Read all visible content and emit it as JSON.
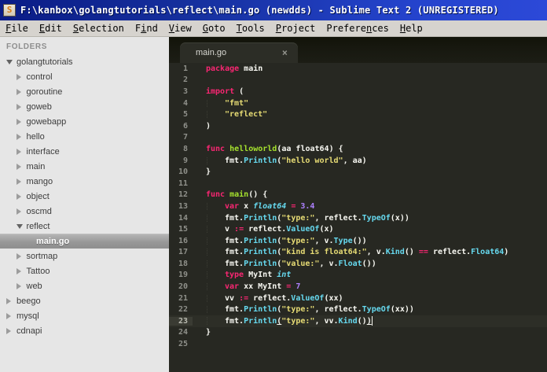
{
  "window": {
    "title": "F:\\kanbox\\golangtutorials\\reflect\\main.go (newdds) - Sublime Text 2 (UNREGISTERED)",
    "icon_letter": "S"
  },
  "menu": {
    "items": [
      {
        "label": "File",
        "underline_index": 0
      },
      {
        "label": "Edit",
        "underline_index": 0
      },
      {
        "label": "Selection",
        "underline_index": 0
      },
      {
        "label": "Find",
        "underline_index": 1
      },
      {
        "label": "View",
        "underline_index": 0
      },
      {
        "label": "Goto",
        "underline_index": 0
      },
      {
        "label": "Tools",
        "underline_index": 0
      },
      {
        "label": "Project",
        "underline_index": 0
      },
      {
        "label": "Preferences",
        "underline_index": 7
      },
      {
        "label": "Help",
        "underline_index": 0
      }
    ]
  },
  "sidebar": {
    "header": "FOLDERS",
    "items": [
      {
        "label": "golangtutorials",
        "level": 0,
        "state": "expanded",
        "selected": false
      },
      {
        "label": "control",
        "level": 1,
        "state": "collapsed",
        "selected": false
      },
      {
        "label": "goroutine",
        "level": 1,
        "state": "collapsed",
        "selected": false
      },
      {
        "label": "goweb",
        "level": 1,
        "state": "collapsed",
        "selected": false
      },
      {
        "label": "gowebapp",
        "level": 1,
        "state": "collapsed",
        "selected": false
      },
      {
        "label": "hello",
        "level": 1,
        "state": "collapsed",
        "selected": false
      },
      {
        "label": "interface",
        "level": 1,
        "state": "collapsed",
        "selected": false
      },
      {
        "label": "main",
        "level": 1,
        "state": "collapsed",
        "selected": false
      },
      {
        "label": "mango",
        "level": 1,
        "state": "collapsed",
        "selected": false
      },
      {
        "label": "object",
        "level": 1,
        "state": "collapsed",
        "selected": false
      },
      {
        "label": "oscmd",
        "level": 1,
        "state": "collapsed",
        "selected": false
      },
      {
        "label": "reflect",
        "level": 1,
        "state": "expanded",
        "selected": false
      },
      {
        "label": "main.go",
        "level": 2,
        "state": "file",
        "selected": true
      },
      {
        "label": "sortmap",
        "level": 1,
        "state": "collapsed",
        "selected": false
      },
      {
        "label": "Tattoo",
        "level": 1,
        "state": "collapsed",
        "selected": false
      },
      {
        "label": "web",
        "level": 1,
        "state": "collapsed",
        "selected": false
      },
      {
        "label": "beego",
        "level": 0,
        "state": "collapsed",
        "selected": false
      },
      {
        "label": "mysql",
        "level": 0,
        "state": "collapsed",
        "selected": false
      },
      {
        "label": "cdnapi",
        "level": 0,
        "state": "collapsed",
        "selected": false
      }
    ]
  },
  "editor": {
    "tab": {
      "label": "main.go",
      "close_glyph": "×"
    },
    "current_line": 23,
    "lines": [
      {
        "num": 1,
        "indent": 0,
        "spans": [
          [
            "kw",
            "package"
          ],
          [
            "pl",
            " main"
          ]
        ]
      },
      {
        "num": 2,
        "indent": 0,
        "spans": []
      },
      {
        "num": 3,
        "indent": 0,
        "spans": [
          [
            "kw",
            "import"
          ],
          [
            "pl",
            " ("
          ]
        ]
      },
      {
        "num": 4,
        "indent": 1,
        "spans": [
          [
            "str",
            "\"fmt\""
          ]
        ]
      },
      {
        "num": 5,
        "indent": 1,
        "spans": [
          [
            "str",
            "\"reflect\""
          ]
        ]
      },
      {
        "num": 6,
        "indent": 0,
        "spans": [
          [
            "pl",
            ")"
          ]
        ]
      },
      {
        "num": 7,
        "indent": 0,
        "spans": []
      },
      {
        "num": 8,
        "indent": 0,
        "spans": [
          [
            "kw",
            "func"
          ],
          [
            "pl",
            " "
          ],
          [
            "fndef",
            "helloworld"
          ],
          [
            "pl",
            "(aa float64) {"
          ]
        ]
      },
      {
        "num": 9,
        "indent": 1,
        "spans": [
          [
            "pl",
            "fmt."
          ],
          [
            "fn",
            "Println"
          ],
          [
            "pl",
            "("
          ],
          [
            "str",
            "\"hello world\""
          ],
          [
            "pl",
            ", aa)"
          ]
        ]
      },
      {
        "num": 10,
        "indent": 0,
        "spans": [
          [
            "pl",
            "}"
          ]
        ]
      },
      {
        "num": 11,
        "indent": 0,
        "spans": []
      },
      {
        "num": 12,
        "indent": 0,
        "spans": [
          [
            "kw",
            "func"
          ],
          [
            "pl",
            " "
          ],
          [
            "fndef",
            "main"
          ],
          [
            "pl",
            "() {"
          ]
        ]
      },
      {
        "num": 13,
        "indent": 1,
        "spans": [
          [
            "kw",
            "var"
          ],
          [
            "pl",
            " x "
          ],
          [
            "ity",
            "float64"
          ],
          [
            "pl",
            " "
          ],
          [
            "kw",
            "="
          ],
          [
            "pl",
            " "
          ],
          [
            "num",
            "3.4"
          ]
        ]
      },
      {
        "num": 14,
        "indent": 1,
        "spans": [
          [
            "pl",
            "fmt."
          ],
          [
            "fn",
            "Println"
          ],
          [
            "pl",
            "("
          ],
          [
            "str",
            "\"type:\""
          ],
          [
            "pl",
            ", reflect."
          ],
          [
            "fn",
            "TypeOf"
          ],
          [
            "pl",
            "(x))"
          ]
        ]
      },
      {
        "num": 15,
        "indent": 1,
        "spans": [
          [
            "pl",
            "v "
          ],
          [
            "kw",
            ":="
          ],
          [
            "pl",
            " reflect."
          ],
          [
            "fn",
            "ValueOf"
          ],
          [
            "pl",
            "(x)"
          ]
        ]
      },
      {
        "num": 16,
        "indent": 1,
        "spans": [
          [
            "pl",
            "fmt."
          ],
          [
            "fn",
            "Println"
          ],
          [
            "pl",
            "("
          ],
          [
            "str",
            "\"type:\""
          ],
          [
            "pl",
            ", v."
          ],
          [
            "fn",
            "Type"
          ],
          [
            "pl",
            "())"
          ]
        ]
      },
      {
        "num": 17,
        "indent": 1,
        "spans": [
          [
            "pl",
            "fmt."
          ],
          [
            "fn",
            "Println"
          ],
          [
            "pl",
            "("
          ],
          [
            "str",
            "\"kind is float64:\""
          ],
          [
            "pl",
            ", v."
          ],
          [
            "fn",
            "Kind"
          ],
          [
            "pl",
            "() "
          ],
          [
            "kw",
            "=="
          ],
          [
            "pl",
            " reflect."
          ],
          [
            "fn",
            "Float64"
          ],
          [
            "pl",
            ")"
          ]
        ]
      },
      {
        "num": 18,
        "indent": 1,
        "spans": [
          [
            "pl",
            "fmt."
          ],
          [
            "fn",
            "Println"
          ],
          [
            "pl",
            "("
          ],
          [
            "str",
            "\"value:\""
          ],
          [
            "pl",
            ", v."
          ],
          [
            "fn",
            "Float"
          ],
          [
            "pl",
            "())"
          ]
        ]
      },
      {
        "num": 19,
        "indent": 1,
        "spans": [
          [
            "kw",
            "type"
          ],
          [
            "pl",
            " MyInt "
          ],
          [
            "ity",
            "int"
          ]
        ]
      },
      {
        "num": 20,
        "indent": 1,
        "spans": [
          [
            "kw",
            "var"
          ],
          [
            "pl",
            " xx MyInt "
          ],
          [
            "kw",
            "="
          ],
          [
            "pl",
            " "
          ],
          [
            "num",
            "7"
          ]
        ]
      },
      {
        "num": 21,
        "indent": 1,
        "spans": [
          [
            "pl",
            "vv "
          ],
          [
            "kw",
            ":="
          ],
          [
            "pl",
            " reflect."
          ],
          [
            "fn",
            "ValueOf"
          ],
          [
            "pl",
            "(xx)"
          ]
        ]
      },
      {
        "num": 22,
        "indent": 1,
        "spans": [
          [
            "pl",
            "fmt."
          ],
          [
            "fn",
            "Println"
          ],
          [
            "pl",
            "("
          ],
          [
            "str",
            "\"type:\""
          ],
          [
            "pl",
            ", reflect."
          ],
          [
            "fn",
            "TypeOf"
          ],
          [
            "pl",
            "(xx))"
          ]
        ]
      },
      {
        "num": 23,
        "indent": 1,
        "spans": [
          [
            "pl",
            "fmt."
          ],
          [
            "fn",
            "Println"
          ],
          [
            "ul",
            "("
          ],
          [
            "str",
            "\"type:\""
          ],
          [
            "pl",
            ", vv."
          ],
          [
            "fn",
            "Kind"
          ],
          [
            "pl",
            "()"
          ],
          [
            "ul",
            ")"
          ],
          [
            "caret",
            ""
          ]
        ]
      },
      {
        "num": 24,
        "indent": 0,
        "spans": [
          [
            "pl",
            "}"
          ]
        ]
      },
      {
        "num": 25,
        "indent": 0,
        "spans": []
      }
    ]
  },
  "colors": {
    "titlebar_blue_left": "#0a1c86",
    "titlebar_blue_right": "#2c49d8",
    "menubar_bg": "#d6d3ce",
    "sidebar_bg": "#e6e6e6",
    "sidebar_selected_bg": "#989898",
    "editor_bg": "#272822",
    "keyword": "#f92672",
    "function_call": "#66d9ef",
    "function_def": "#a6e22e",
    "string": "#e6db74",
    "number": "#ae81ff",
    "plain": "#f8f8f2",
    "line_number": "#8f908a"
  }
}
